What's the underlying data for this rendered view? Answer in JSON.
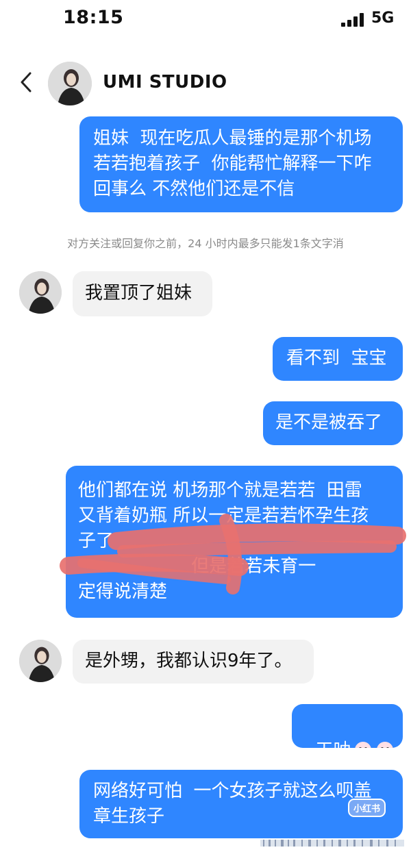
{
  "status_bar": {
    "time": "18:15",
    "network": "5G"
  },
  "header": {
    "title": "UMI STUDIO"
  },
  "notice": "对方关注或回复你之前，24 小时内最多只能发1条文字消",
  "messages": [
    {
      "side": "out",
      "text": "姐妹  现在吃瓜人最锤的是那个机场\n若若抱着孩子  你能帮忙解释一下咋\n回事么 不然他们还是不信"
    },
    {
      "side": "in",
      "text": "我置顶了姐妹"
    },
    {
      "side": "out",
      "text": "看不到  宝宝"
    },
    {
      "side": "out",
      "text": "是不是被吞了"
    },
    {
      "side": "out",
      "text": "他们都在说 机场那个就是若若  田雷\n又背着奶瓶 所以一定是若若怀孕生孩\n子了\n                    但是若若未育一\n定得说清楚"
    },
    {
      "side": "in",
      "text": "是外甥，我都认识9年了。"
    },
    {
      "side": "out",
      "text": "天呐"
    },
    {
      "side": "out",
      "text": "网络好可怕  一个女孩子就这么呗盖\n章生孩子"
    }
  ],
  "watermark": {
    "label": "小红书"
  },
  "colors": {
    "outgoing_bubble": "#2f86ff",
    "incoming_bubble": "#f2f2f2",
    "scribble": "#e8716f"
  },
  "icons": [
    "back-chevron-icon",
    "avatar",
    "signal-icon",
    "emoji-icon"
  ]
}
